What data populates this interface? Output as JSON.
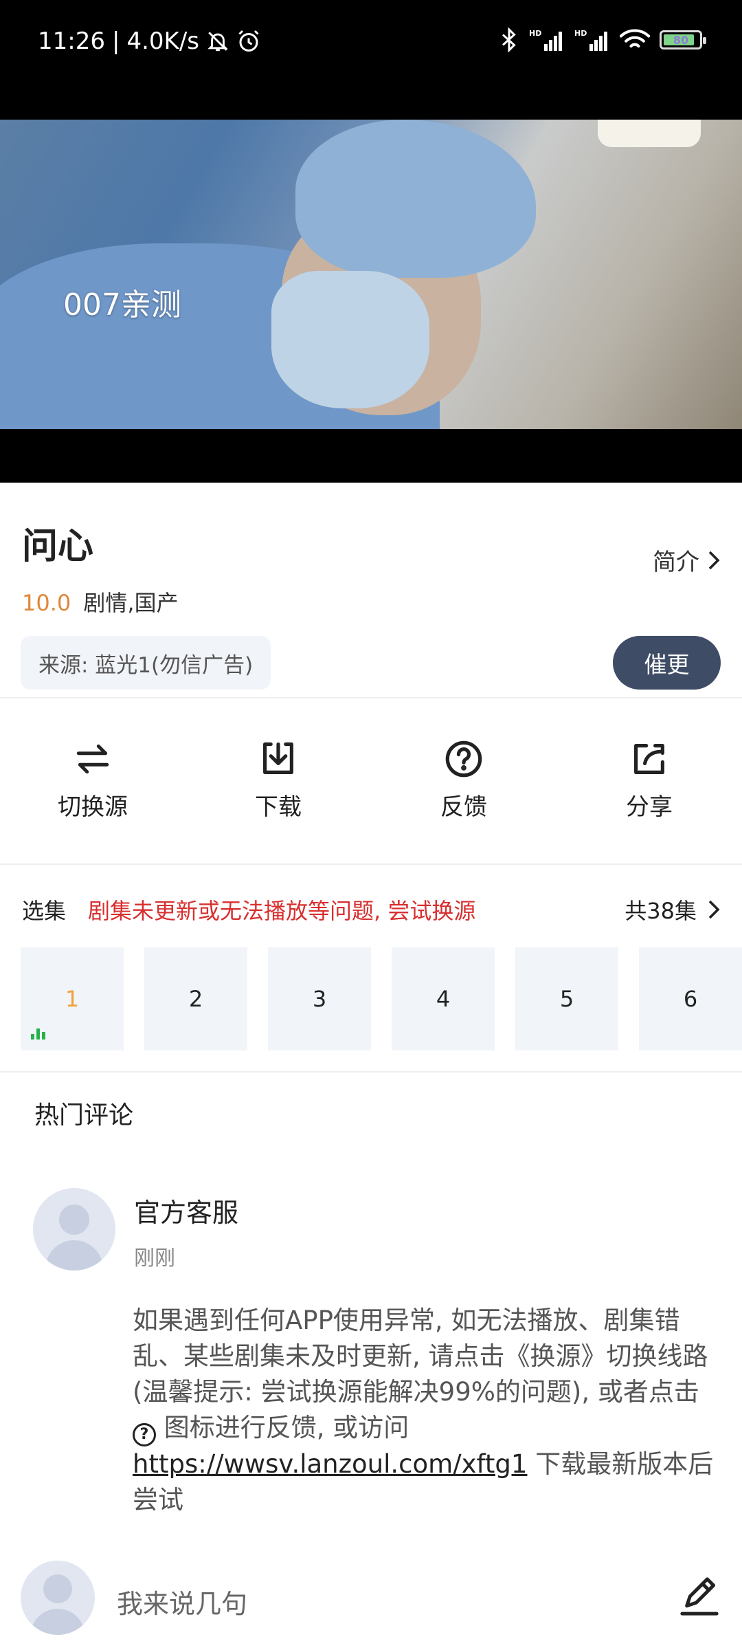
{
  "status_bar": {
    "time": "11:26",
    "speed": "4.0K/s",
    "icons": [
      "bell-off-icon",
      "alarm-icon",
      "bluetooth-icon",
      "hd-signal-icon",
      "hd-signal-icon",
      "wifi-icon",
      "battery-icon"
    ],
    "hd_label": "HD",
    "battery_level": "80"
  },
  "player": {
    "overlay_text": "007亲测"
  },
  "show": {
    "title": "问心",
    "intro_label": "简介",
    "score": "10.0",
    "genres": "剧情,国产",
    "source": "来源: 蓝光1(勿信广告)",
    "urge_button": "催更"
  },
  "actions": [
    {
      "label": "切换源",
      "icon": "switch-source-icon"
    },
    {
      "label": "下载",
      "icon": "download-icon"
    },
    {
      "label": "反馈",
      "icon": "feedback-icon"
    },
    {
      "label": "分享",
      "icon": "share-icon"
    }
  ],
  "episodes": {
    "label": "选集",
    "warning": "剧集未更新或无法播放等问题, 尝试换源",
    "total": "共38集",
    "items": [
      "1",
      "2",
      "3",
      "4",
      "5",
      "6"
    ],
    "active_index": 0
  },
  "comments": {
    "heading": "热门评论",
    "items": [
      {
        "name": "官方客服",
        "time": "刚刚",
        "text_part1": "如果遇到任何APP使用异常, 如无法播放、剧集错乱、某些剧集未及时更新, 请点击《换源》切换线路(温馨提示: 尝试换源能解决99%的问题), 或者点击",
        "text_part2": "图标进行反馈, 或访问",
        "link": "https://wwsv.lanzoul.com/xftg1",
        "text_part3": "下载最新版本后尝试"
      }
    ]
  },
  "input": {
    "placeholder": "我来说几句"
  },
  "colors": {
    "accent_dark": "#3f4c65",
    "score": "#e0883a",
    "warning": "#d82f2f",
    "active_episode": "#f0a13a",
    "playing_bars": "#26b24b"
  }
}
